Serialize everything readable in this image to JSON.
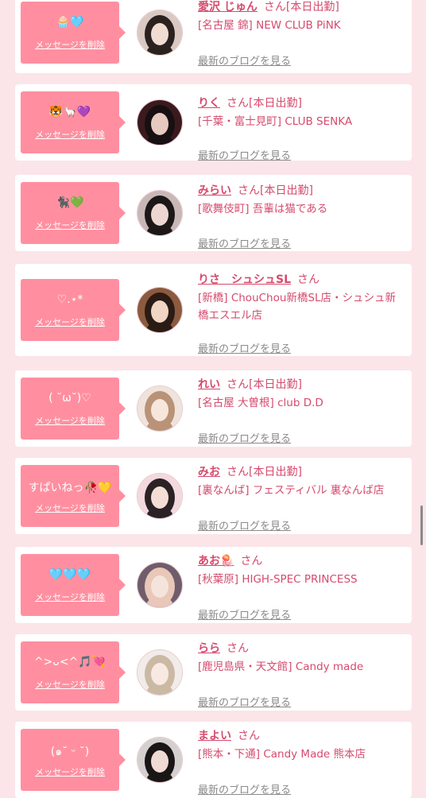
{
  "delete_label": "メッセージを削除",
  "blog_label": "最新のブログを見る",
  "colors": {
    "accent": "#d64a6e",
    "bubble": "#ff8fa0",
    "background": "#fbe5e9"
  },
  "items": [
    {
      "message": "🧁🩵",
      "name": "愛沢 じゅん",
      "san": "さん",
      "status": "[本日出勤]",
      "shop": "[名古屋 錦] NEW CLUB PiNK"
    },
    {
      "message": "🐯🦙💜",
      "name": "りく",
      "san": "さん",
      "status": "[本日出勤]",
      "shop": "[千葉・富士見町] CLUB SENKA"
    },
    {
      "message": "🐈‍⬛💚",
      "name": "みらい",
      "san": "さん",
      "status": "[本日出勤]",
      "shop": "[歌舞伎町] 吾輩は猫である"
    },
    {
      "message": "♡.⋆*",
      "name": "りさ　シュシュSL",
      "san": "さん",
      "status": "",
      "shop": "[新橋] ChouChou新橋SL店・シュシュ新橋エスエル店"
    },
    {
      "message": "( ˘ω˘)♡",
      "name": "れい",
      "san": "さん",
      "status": "[本日出勤]",
      "shop": "[名古屋 大曽根] club D.D"
    },
    {
      "message": "すぱいねっ🥀💛",
      "name": "みお",
      "san": "さん",
      "status": "[本日出勤]",
      "shop": "[裏なんば] フェスティバル 裏なんば店"
    },
    {
      "message": "🩵🩵🩵",
      "name": "あお🪼",
      "san": "さん",
      "status": "",
      "shop": "[秋葉原] HIGH-SPEC PRINCESS"
    },
    {
      "message": "^>ᴗ<^🎵💘",
      "name": "らら",
      "san": "さん",
      "status": "",
      "shop": "[鹿児島県・天文館] Candy made"
    },
    {
      "message": "(๑˘ ᵕ ˘)",
      "name": "まよい",
      "san": "さん",
      "status": "",
      "shop": "[熊本・下通] Candy Made 熊本店"
    }
  ]
}
